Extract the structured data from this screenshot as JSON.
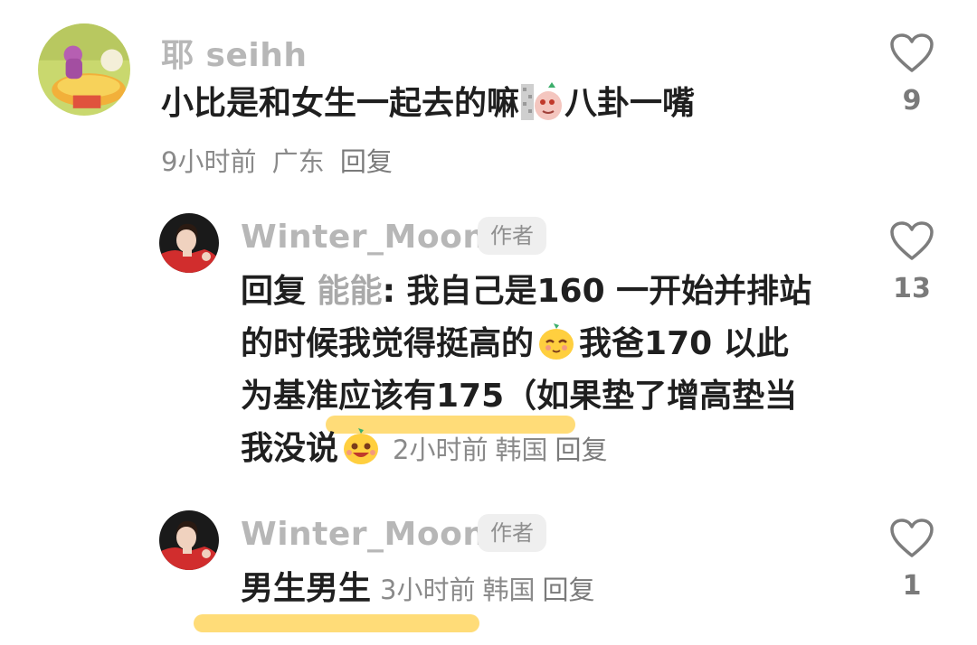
{
  "comments": [
    {
      "username": "耶 seihh",
      "text_before_emoji": "小比是和女生一起去的嘛",
      "emoji_name": "pig-peek-emoji",
      "text_after_emoji": "八卦一嘴",
      "time": "9小时前",
      "location": "广东",
      "reply_label": "回复",
      "likes": "9",
      "avatar_icon": "teletubby-avatar-icon"
    },
    {
      "username": "Winter_Moon",
      "badge": "作者",
      "reply_prefix": "回复 ",
      "reply_target": "能能",
      "line1": ": 我自己是160 一开始并排站",
      "line2_before_emoji": "的时候我觉得挺高的",
      "emoji1": "mango-shy-emoji",
      "line2_after_emoji": "我爸170 以此",
      "line3": "为基准应该有175（如果垫了增高垫当",
      "line4_before_emoji": "我没说",
      "emoji2": "mango-grin-emoji",
      "time": "2小时前",
      "location": "韩国",
      "reply_label": "回复",
      "likes": "13",
      "avatar_icon": "portrait-avatar-icon"
    },
    {
      "username": "Winter_Moon",
      "badge": "作者",
      "text": "男生男生",
      "time": "3小时前",
      "location": "韩国",
      "reply_label": "回复",
      "likes": "1",
      "avatar_icon": "portrait-avatar-icon"
    }
  ],
  "colors": {
    "highlight": "#ffd869",
    "username": "#b7b7b7",
    "text": "#1f1f1f",
    "meta": "#8a8a8a"
  }
}
